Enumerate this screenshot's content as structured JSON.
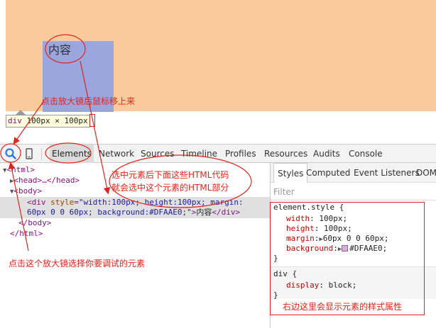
{
  "viewport": {
    "div_text": "内容",
    "tooltip_tag": "div",
    "tooltip_size": "100px × 100px",
    "body_color": "#f9cb9c",
    "div_highlight_color": "#9aa6dd"
  },
  "toolbar": {
    "inspect_icon": "magnifier-icon",
    "device_icon": "mobile-device-icon",
    "tabs": [
      "Elements",
      "Network",
      "Sources",
      "Timeline",
      "Profiles",
      "Resources",
      "Audits",
      "Console"
    ],
    "active_tab": "Elements"
  },
  "elements_tree": {
    "html_open": "<html>",
    "head_collapsed": "<head>…</head>",
    "body_open": "<body>",
    "div_open_tag": "<div",
    "div_attr_name": "style",
    "div_attr_value_line1": "\"width:100px; height:100px; margin:",
    "div_attr_value_line2": "60px 0 0 60px; background:#DFAAE0;\"",
    "div_close_bracket": ">",
    "div_text": "内容",
    "div_close_tag": "</div>",
    "body_close": "</body>",
    "html_close": "</html>"
  },
  "styles_panel": {
    "tabs": [
      "Styles",
      "Computed",
      "Event Listeners",
      "DOM"
    ],
    "active_tab": "Styles",
    "filter_placeholder": "Filter",
    "element_style": {
      "selector": "element.style {",
      "props": [
        {
          "name": "width",
          "value": "100px;"
        },
        {
          "name": "height",
          "value": "100px;"
        },
        {
          "name": "margin",
          "value": "60px 0 0 60px;"
        },
        {
          "name": "background",
          "value": "#DFAAE0;"
        }
      ],
      "close": "}"
    },
    "div_rule": {
      "selector": "div {",
      "props": [
        {
          "name": "display",
          "value": "block;"
        }
      ],
      "close": "}"
    },
    "swatch_color": "#DFAAE0"
  },
  "annotations": {
    "magnifier_move": "点击放大镜后鼠标移上来",
    "html_code_line1": "选中元素后下面这些HTML代码",
    "html_code_line2": "就会选中这个元素的HTML部分",
    "select_element": "点击这个放大镜选择你要调试的元素",
    "style_props": "右边这里会显示元素的样式属性",
    "annotation_color": "#e2231a"
  }
}
